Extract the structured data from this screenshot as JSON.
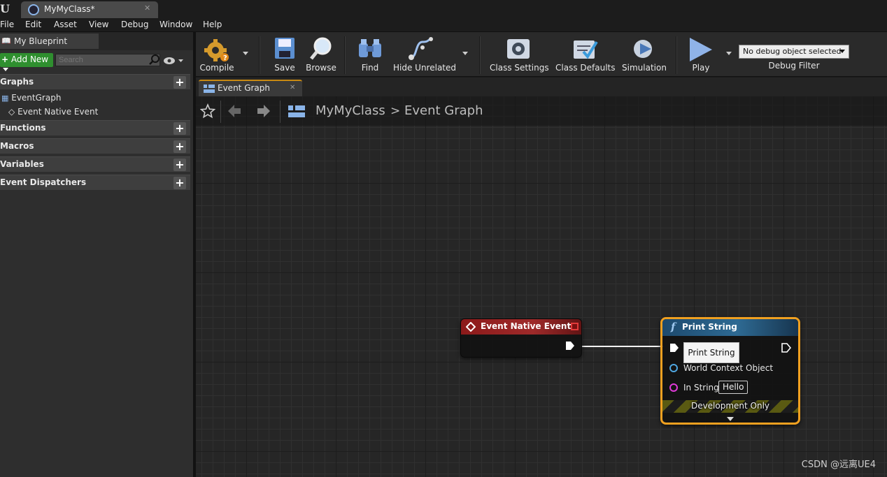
{
  "window": {
    "doc_tab": "MyMyClass*"
  },
  "menu": [
    "File",
    "Edit",
    "Asset",
    "View",
    "Debug",
    "Window",
    "Help"
  ],
  "my_blueprint": {
    "tab_label": "My Blueprint",
    "add_new": "Add New",
    "search_placeholder": "Search",
    "sections": {
      "graphs": "Graphs",
      "functions": "Functions",
      "macros": "Macros",
      "variables": "Variables",
      "event_dispatchers": "Event Dispatchers"
    },
    "graph_items": [
      "EventGraph",
      "Event Native Event"
    ]
  },
  "toolbar": {
    "compile": "Compile",
    "save": "Save",
    "browse": "Browse",
    "find": "Find",
    "hide_unrelated": "Hide Unrelated",
    "class_settings": "Class Settings",
    "class_defaults": "Class Defaults",
    "simulation": "Simulation",
    "play": "Play",
    "debug_select": "No debug object selected",
    "debug_filter": "Debug Filter"
  },
  "graph_tab": "Event Graph",
  "breadcrumb": {
    "class_name": "MyMyClass",
    "separator": ">",
    "graph_name": "Event Graph"
  },
  "nodes": {
    "event": {
      "title": "Event Native Event"
    },
    "print": {
      "title": "Print String",
      "world_context": "World Context Object",
      "in_string_label": "In String",
      "in_string_value": "Hello",
      "development_only": "Development Only"
    }
  },
  "tooltip": "Print String",
  "watermark": "CSDN @远离UE4",
  "colors": {
    "event_header": "#9e2a2a",
    "function_header": "#2e6a93",
    "selection_outline": "#f0a020",
    "add_new_green": "#2f8f2f"
  }
}
